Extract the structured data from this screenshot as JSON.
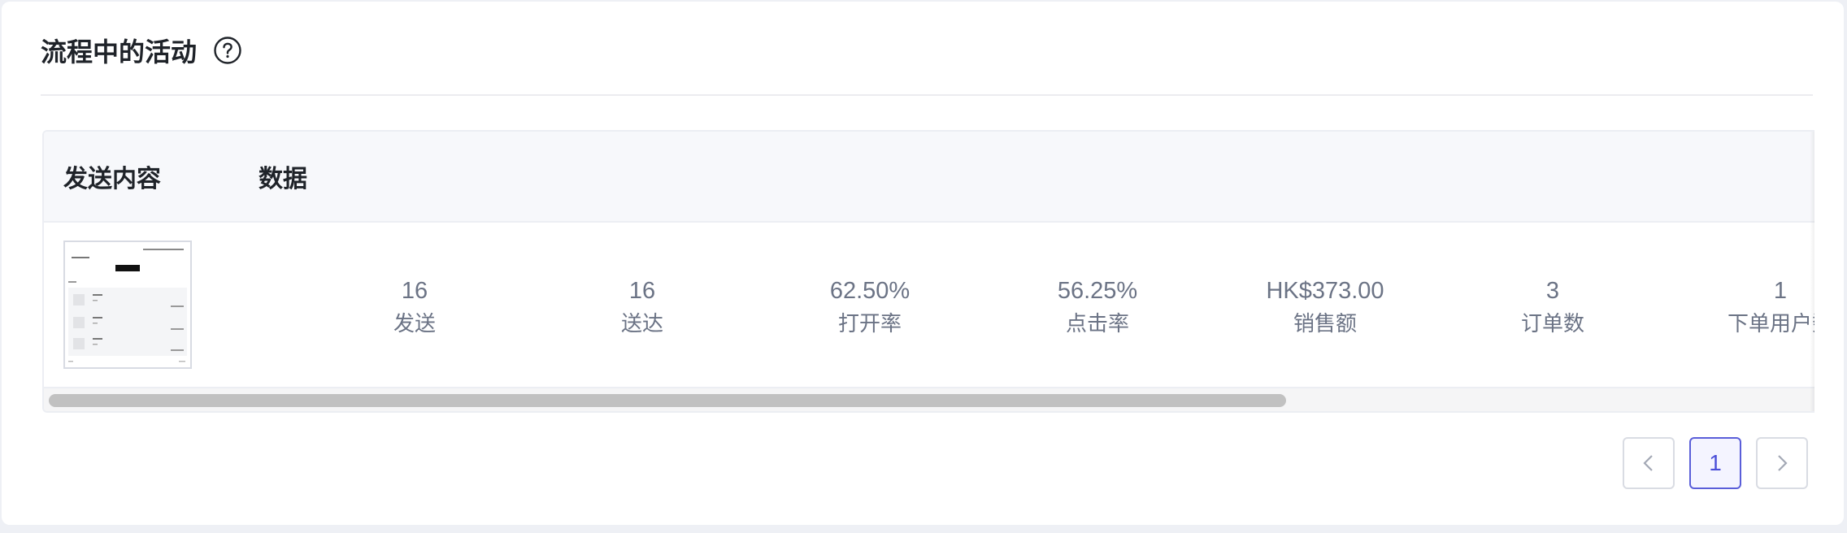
{
  "header": {
    "title": "流程中的活动",
    "help_icon": "question-circle-icon"
  },
  "table": {
    "columns": {
      "content": "发送内容",
      "data": "数据"
    },
    "row": {
      "stats": [
        {
          "value": "16",
          "label": "发送"
        },
        {
          "value": "16",
          "label": "送达"
        },
        {
          "value": "62.50%",
          "label": "打开率"
        },
        {
          "value": "56.25%",
          "label": "点击率"
        },
        {
          "value": "HK$373.00",
          "label": "销售额"
        },
        {
          "value": "3",
          "label": "订单数"
        },
        {
          "value": "1",
          "label": "下单用户数"
        }
      ]
    }
  },
  "pagination": {
    "prev_icon": "chevron-left-icon",
    "current_page": "1",
    "next_icon": "chevron-right-icon"
  },
  "colors": {
    "accent": "#5a5ed9",
    "stat_text": "#6b7385",
    "header_bg": "#f7f8fb"
  }
}
